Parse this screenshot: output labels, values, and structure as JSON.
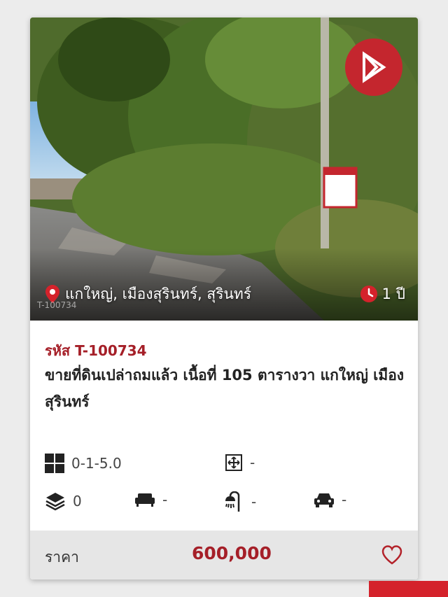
{
  "listing": {
    "location": "แกใหญ่, เมืองสุรินทร์, สุรินทร์",
    "age": "1 ปี",
    "watermark": "T-100734",
    "code": "รหัส T-100734",
    "title": "ขายที่ดินเปล่าถมแล้ว เนื้อที่ 105 ตารางวา แกใหญ่ เมืองสุรินทร์",
    "features": {
      "land_area": "0-1-5.0",
      "usable_area": "-",
      "floors": "0",
      "bedrooms": "-",
      "bathrooms": "-",
      "parking": "-"
    },
    "price_label": "ราคา",
    "price_value": "600,000"
  },
  "colors": {
    "brand": "#c4262e",
    "accent_text": "#a51f28",
    "price_bar": "#e6e6e6"
  },
  "icons": [
    "brand-logo-icon",
    "location-pin-icon",
    "clock-icon",
    "grid-icon",
    "area-expand-icon",
    "layers-icon",
    "sofa-icon",
    "shower-icon",
    "car-icon",
    "heart-icon"
  ]
}
